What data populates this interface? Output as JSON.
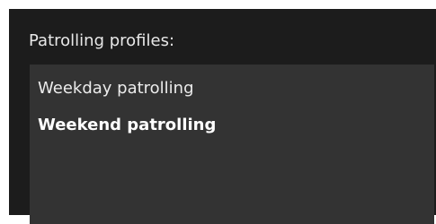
{
  "panel": {
    "title": "Patrolling profiles:",
    "background": "#1c1c1c",
    "list_background": "#333333"
  },
  "profiles": {
    "items": [
      {
        "label": "Weekday patrolling",
        "selected": false
      },
      {
        "label": "Weekend patrolling",
        "selected": true
      }
    ]
  }
}
